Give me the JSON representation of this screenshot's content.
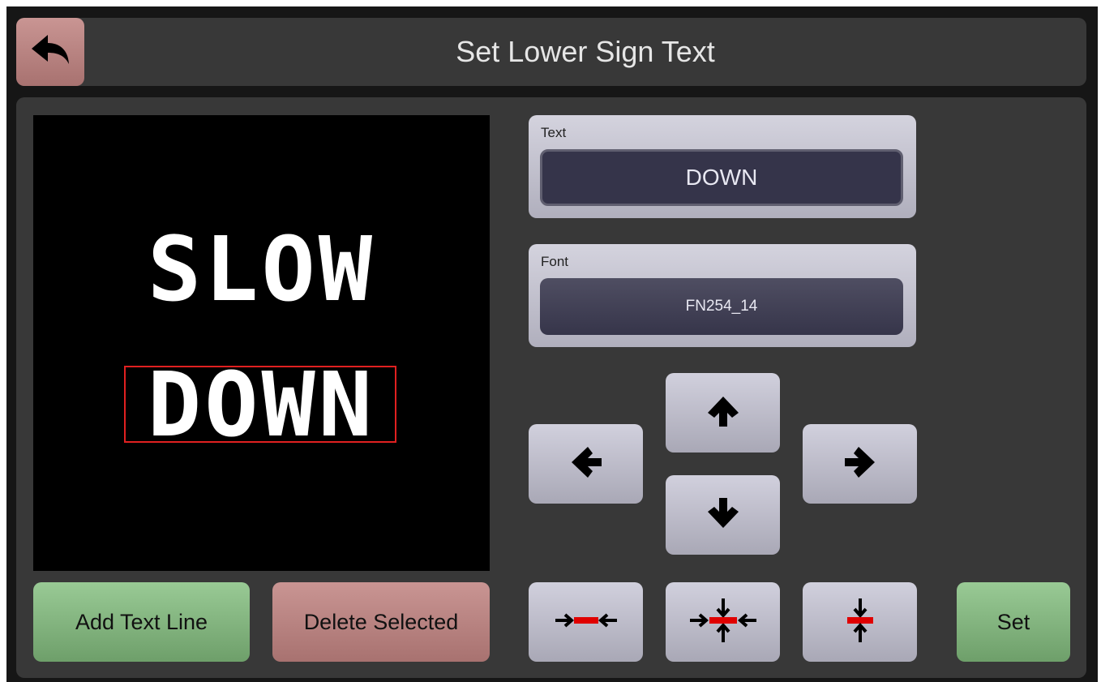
{
  "header": {
    "title": "Set Lower Sign Text"
  },
  "preview": {
    "lines": [
      "SLOW",
      "DOWN"
    ],
    "selected_line": 2
  },
  "text_field": {
    "label": "Text",
    "value": "DOWN"
  },
  "font_field": {
    "label": "Font",
    "value": "FN254_14"
  },
  "buttons": {
    "add_line": "Add Text Line",
    "delete_selected": "Delete Selected",
    "set": "Set"
  },
  "icons": {
    "back": "back-arrow-icon",
    "up": "arrow-up-icon",
    "down": "arrow-down-icon",
    "left": "arrow-left-icon",
    "right": "arrow-right-icon",
    "center_h": "center-horizontal-icon",
    "center_both": "center-both-icon",
    "center_v": "center-vertical-icon"
  },
  "colors": {
    "accent_green": "#7fb27b",
    "accent_red": "#b98280",
    "selection": "#e02020",
    "marker": "#e00000"
  }
}
